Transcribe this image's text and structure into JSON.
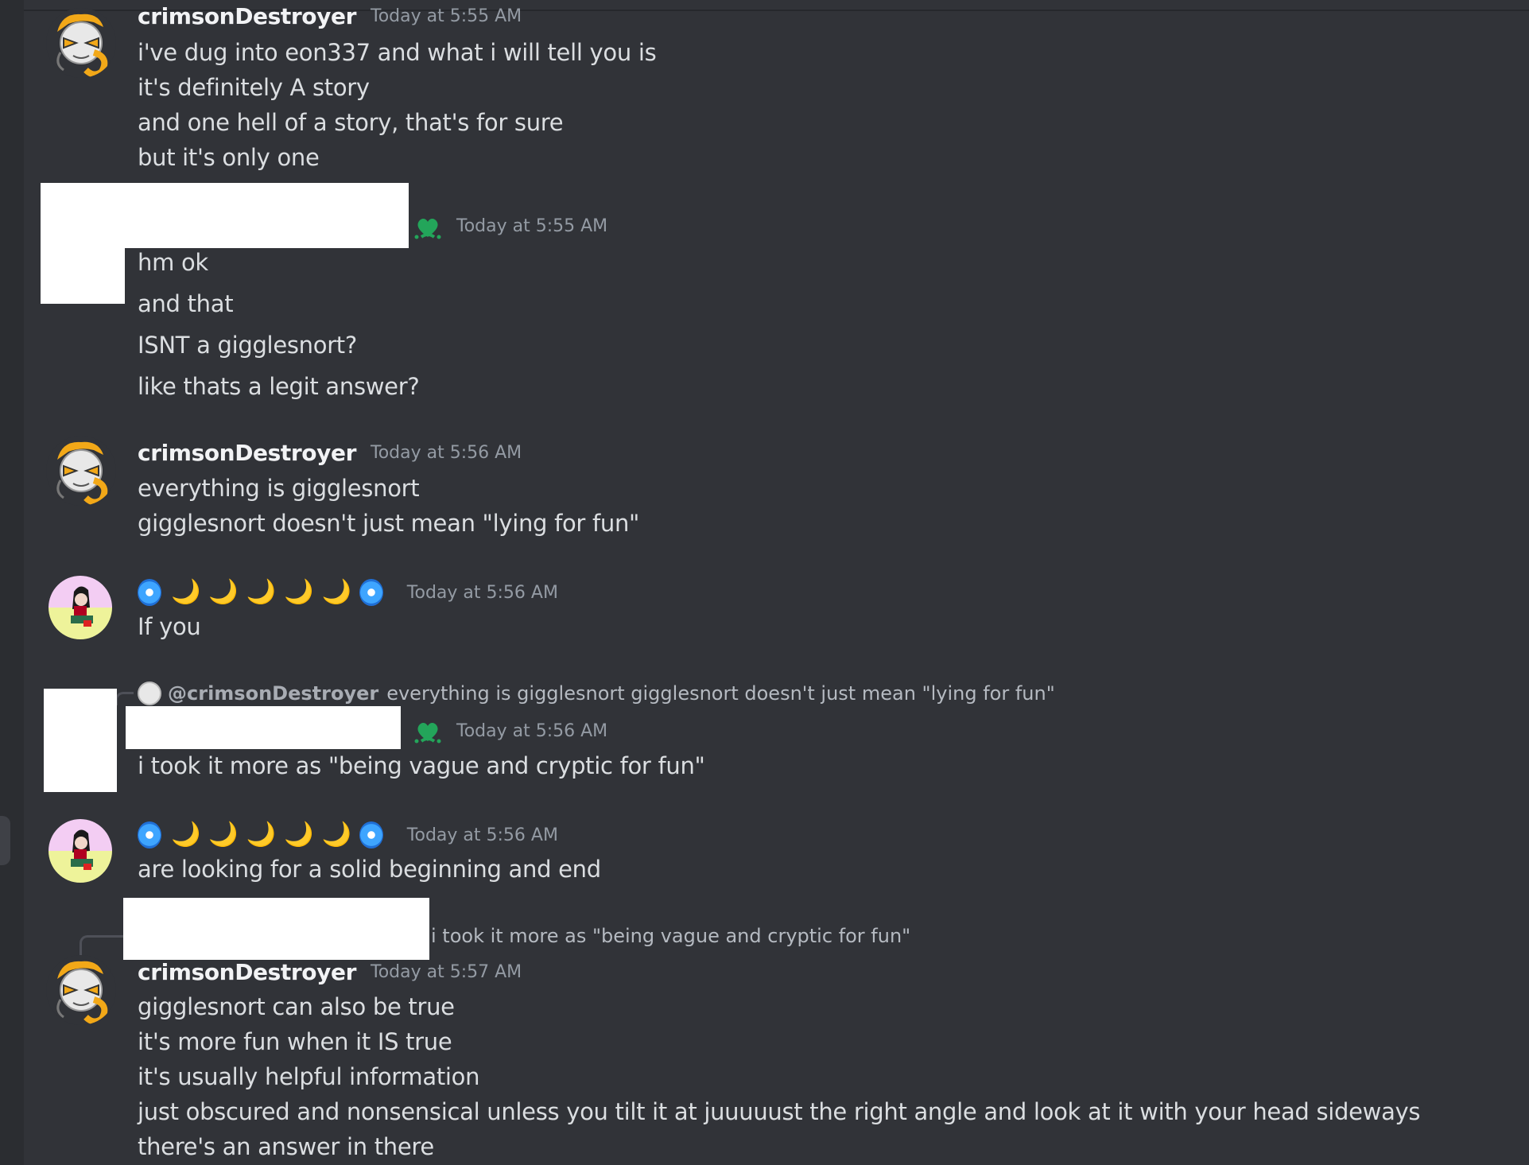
{
  "messages": [
    {
      "username": "crimsonDestroyer",
      "timestamp": "Today at 5:55 AM",
      "lines": [
        "i've dug into eon337 and what i will tell you is",
        "it's definitely A story",
        "and one hell of a story, that's for sure",
        "but it's only one"
      ]
    },
    {
      "username": "",
      "timestamp": "Today at 5:55 AM",
      "lines": [
        "hm ok",
        "and that",
        "ISNT a gigglesnort?",
        "like thats a legit answer?"
      ]
    },
    {
      "username": "crimsonDestroyer",
      "timestamp": "Today at 5:56 AM",
      "lines": [
        "everything is gigglesnort",
        "gigglesnort doesn't just mean \"lying for fun\""
      ]
    },
    {
      "username_emoji": [
        "🌀",
        "🌙",
        "🌙",
        "🌙",
        "🌙",
        "🌙",
        "🌀"
      ],
      "timestamp": "Today at 5:56 AM",
      "lines": [
        "If you"
      ]
    },
    {
      "reply": {
        "mention": "@crimsonDestroyer",
        "text": "everything is gigglesnort gigglesnort doesn't just mean \"lying for fun\""
      },
      "timestamp": "Today at 5:56 AM",
      "lines": [
        "i took it more as \"being vague and cryptic for fun\""
      ]
    },
    {
      "username_emoji": [
        "🌀",
        "🌙",
        "🌙",
        "🌙",
        "🌙",
        "🌙",
        "🌀"
      ],
      "timestamp": "Today at 5:56 AM",
      "lines": [
        "are looking for a solid beginning and end"
      ]
    },
    {
      "reply": {
        "text": "i took it more as \"being vague and cryptic for fun\""
      },
      "username": "crimsonDestroyer",
      "timestamp": "Today at 5:57 AM",
      "lines": [
        "gigglesnort can also be true",
        "it's more fun when it IS true",
        "it's usually helpful information",
        "just obscured and nonsensical unless you tilt it at juuuuust the right angle and look at it with your head sideways",
        "there's an answer in there"
      ]
    }
  ],
  "colors": {
    "background": "#313338",
    "text": "#dbdee1",
    "username": "#f2f3f5",
    "timestamp": "#949ba4",
    "role_icon": "#23a55a"
  },
  "icons": {
    "role": "green-heart-flower-icon",
    "moon": "crescent-moon-emoji",
    "cyclone": "cyclone-emoji"
  }
}
